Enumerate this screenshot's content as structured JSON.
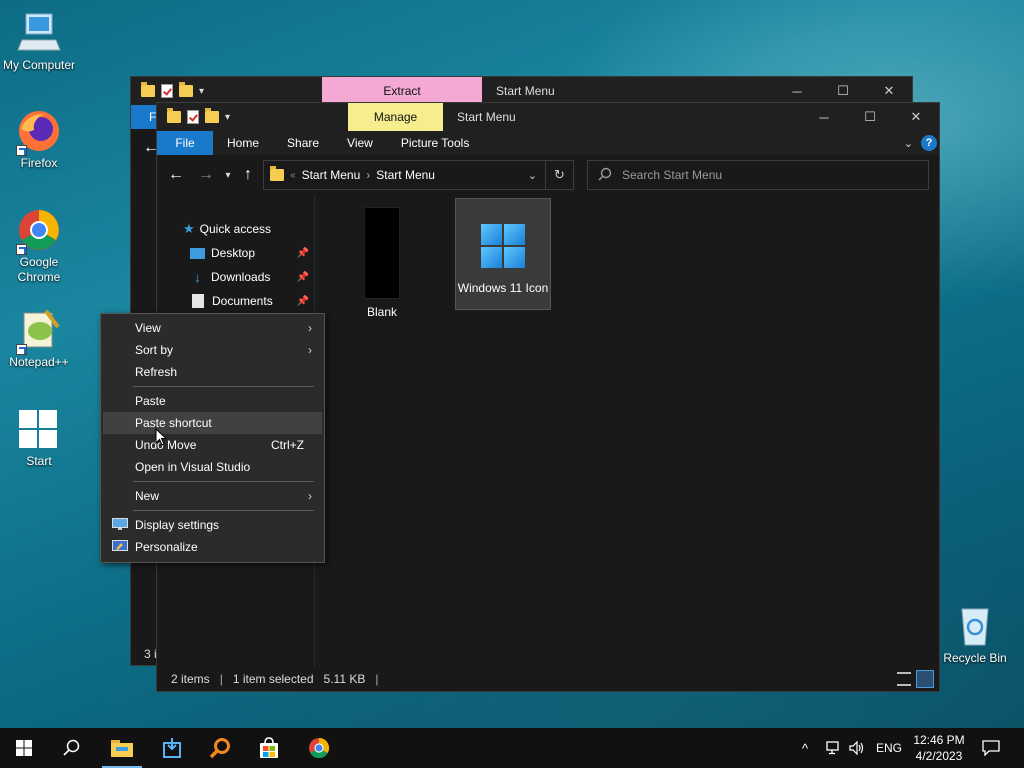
{
  "desktop": {
    "icons": [
      {
        "label": "My Computer"
      },
      {
        "label": "Firefox"
      },
      {
        "label": "Google Chrome"
      },
      {
        "label": "Notepad++"
      },
      {
        "label": "Start"
      },
      {
        "label": "Recycle Bin"
      }
    ]
  },
  "back_window": {
    "context_tab": "Extract",
    "title": "Start Menu",
    "context_tab_color": "#f3a9d4",
    "ribbon_partial": "F",
    "status_partial": "3 i"
  },
  "window": {
    "context_tab": "Manage",
    "context_tab_color": "#f6ed8f",
    "title": "Start Menu",
    "controls": {
      "minimize": "─",
      "maximize": "☐",
      "close": "✕"
    },
    "ribbon_tabs": [
      "File",
      "Home",
      "Share",
      "View",
      "Picture Tools"
    ],
    "breadcrumb": {
      "sep0": "«",
      "part1": "Start Menu",
      "sep1": "›",
      "part2": "Start Menu"
    },
    "search_placeholder": "Search Start Menu",
    "nav": [
      {
        "label": "Quick access"
      },
      {
        "label": "Desktop"
      },
      {
        "label": "Downloads"
      },
      {
        "label": "Documents"
      }
    ],
    "files": [
      {
        "name": "Blank"
      },
      {
        "name": "Windows 11 Icon"
      }
    ],
    "status": {
      "items": "2 items",
      "selected": "1 item selected",
      "size": "5.11 KB"
    }
  },
  "context_menu": {
    "items": [
      {
        "label": "View"
      },
      {
        "label": "Sort by"
      },
      {
        "label": "Refresh"
      },
      {
        "label": "Paste"
      },
      {
        "label": "Paste shortcut"
      },
      {
        "label": "Undo Move",
        "shortcut": "Ctrl+Z"
      },
      {
        "label": "Open in Visual Studio"
      },
      {
        "label": "New"
      },
      {
        "label": "Display settings"
      },
      {
        "label": "Personalize"
      }
    ]
  },
  "taskbar": {
    "language": "ENG",
    "time": "12:46 PM",
    "date": "4/2/2023"
  },
  "colors": {
    "accent": "#1979ca",
    "menu_bg": "#2b2b2b",
    "explorer_bg": "#191919"
  }
}
